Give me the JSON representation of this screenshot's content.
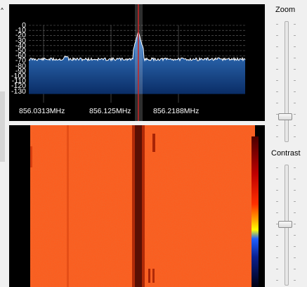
{
  "spectrum": {
    "y_labels": [
      "0",
      "-10",
      "-20",
      "-30",
      "-40",
      "-50",
      "-60",
      "-70",
      "-80",
      "-90",
      "-100",
      "-110",
      "-120",
      "-130"
    ],
    "freq_labels": [
      "856.0313MHz",
      "856.125MHz",
      "856.2188MHz"
    ]
  },
  "controls": {
    "zoom_label": "Zoom",
    "contrast_label": "Contrast",
    "zoom_level": 0.15,
    "contrast_level": 0.47
  },
  "colors": {
    "background": "#000000",
    "spectrum_fill_top": "#3d86d6",
    "spectrum_fill_bottom": "#0a2d66",
    "trace": "#ffffff",
    "waterfall_base": "#ff5a1a",
    "center_marker": "#cc2222"
  }
}
